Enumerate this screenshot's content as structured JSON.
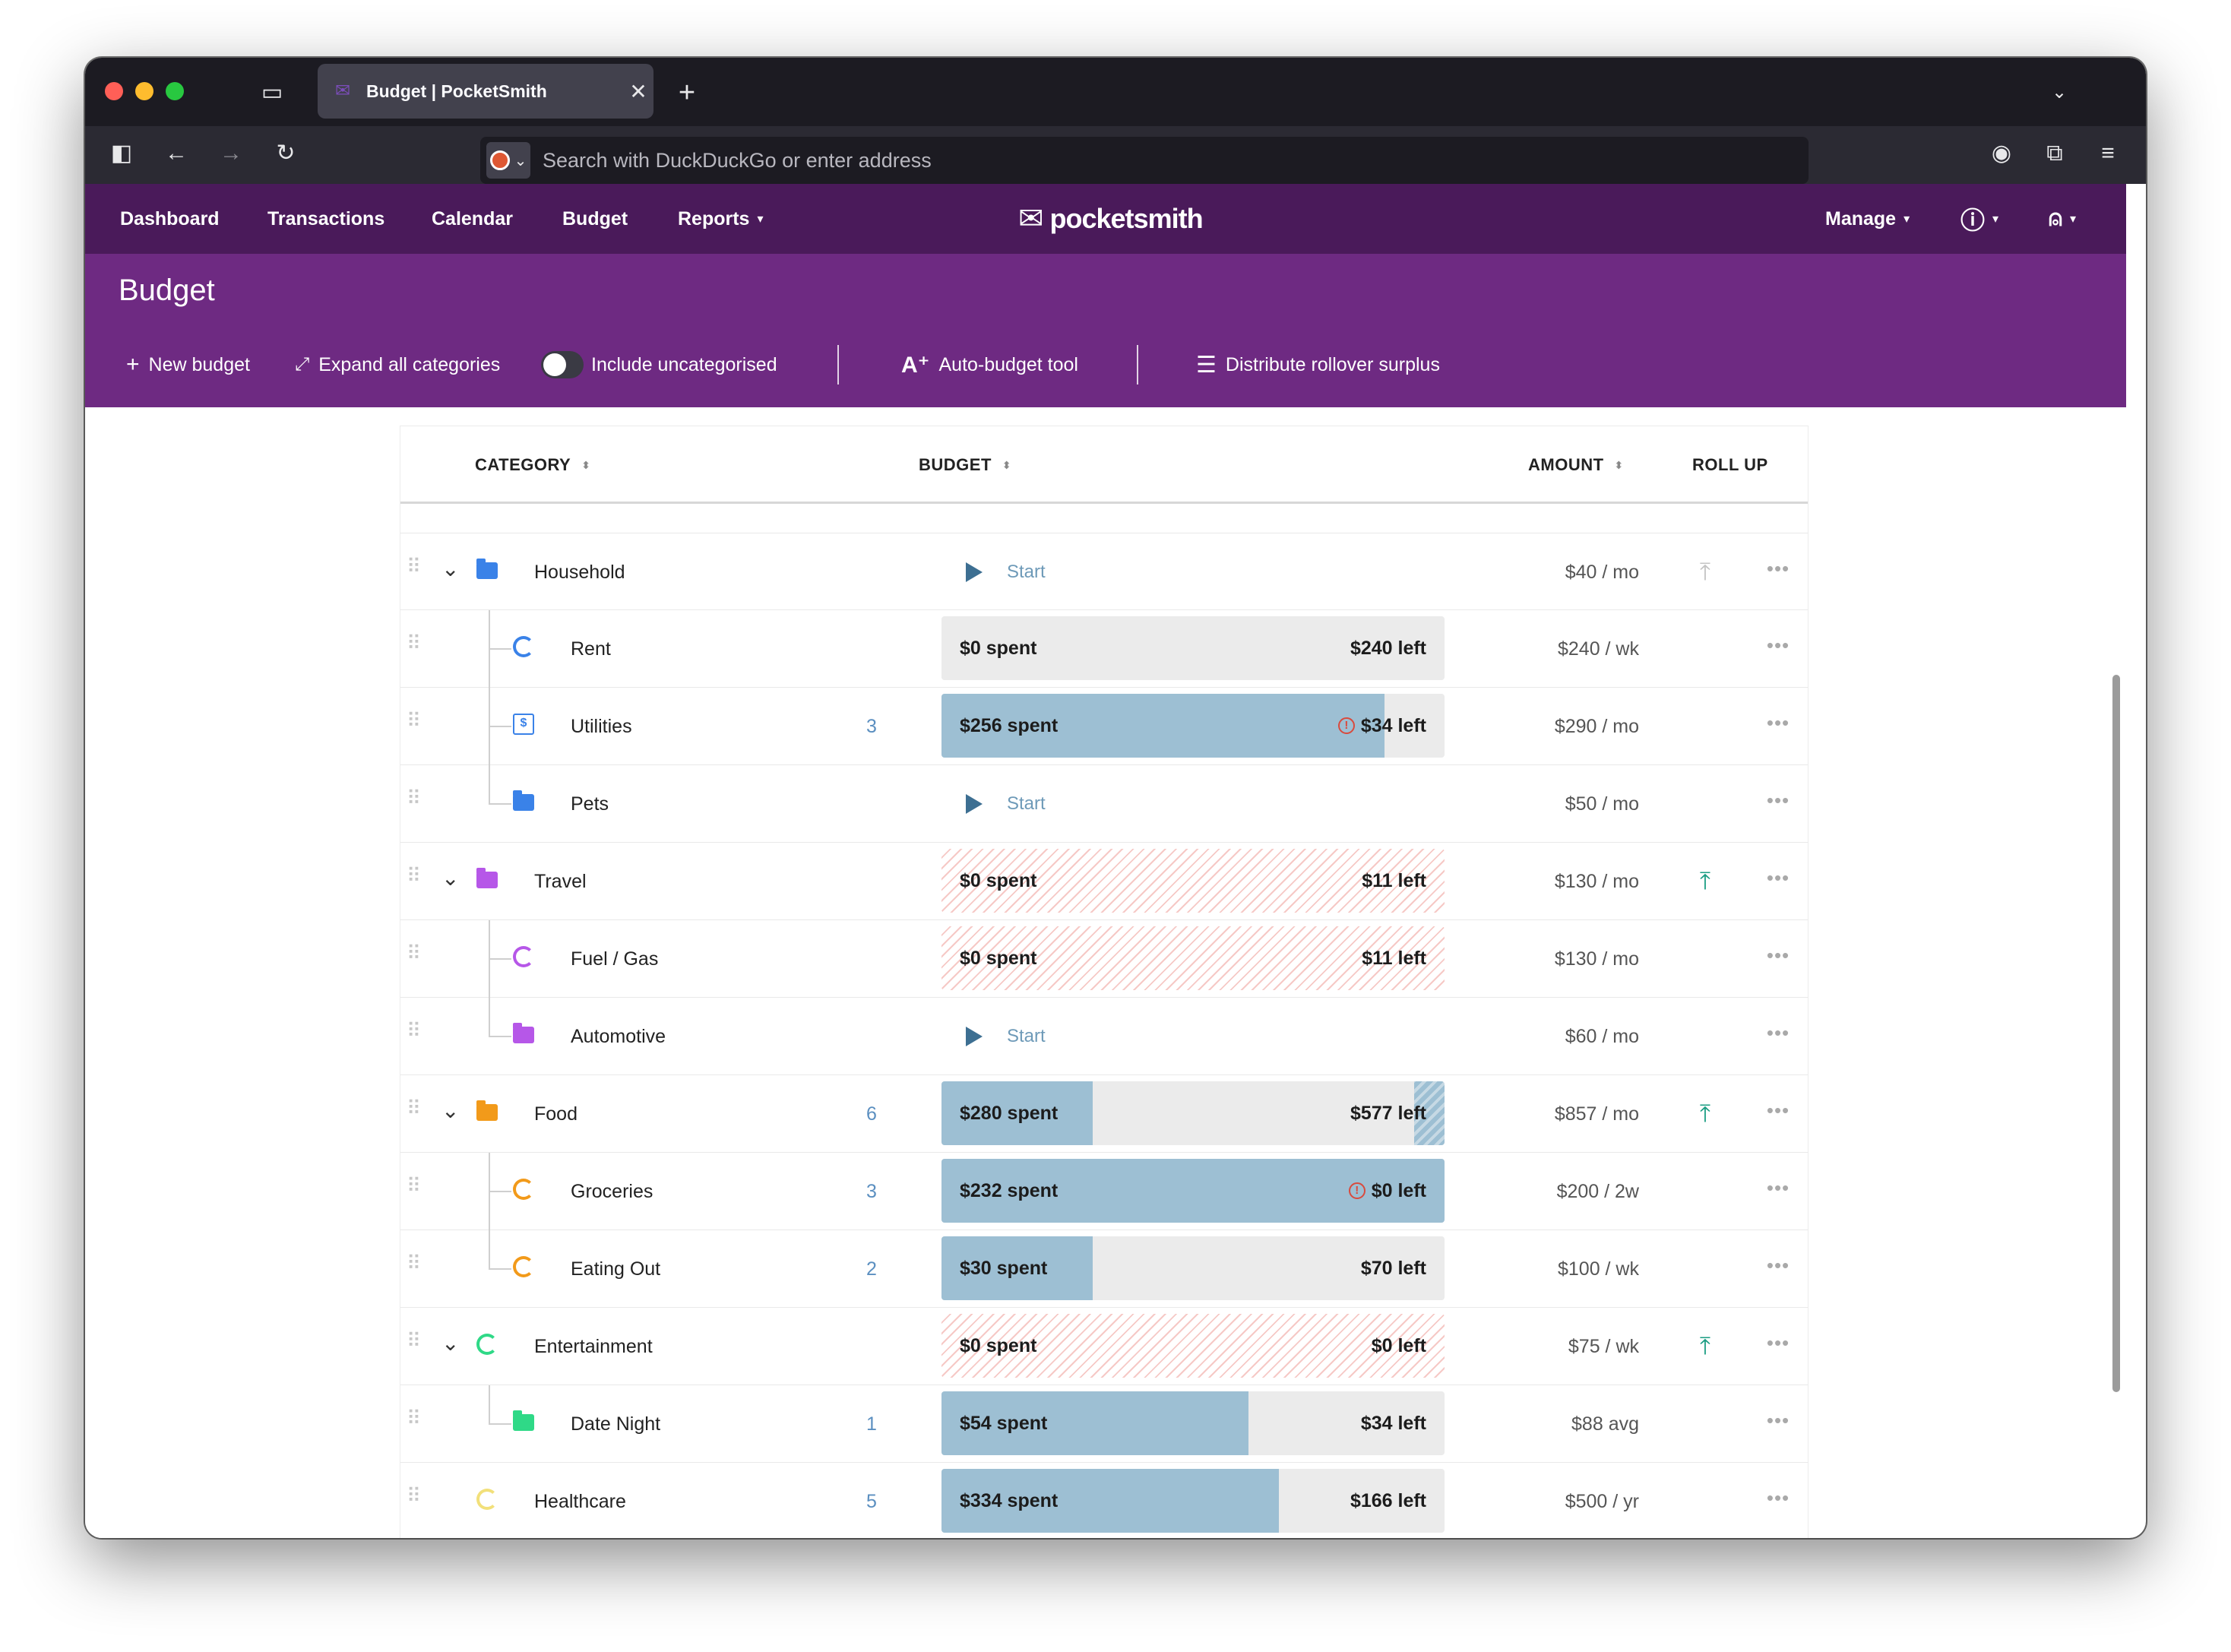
{
  "browser": {
    "tab_title": "Budget | PocketSmith",
    "tab_close": "✕",
    "new_tab": "+",
    "url_placeholder": "Search with DuckDuckGo or enter address"
  },
  "app": {
    "nav": {
      "dashboard": "Dashboard",
      "transactions": "Transactions",
      "calendar": "Calendar",
      "budget": "Budget",
      "reports": "Reports",
      "manage": "Manage"
    },
    "logo": "pocketsmith",
    "brand_color": "#6e2a82",
    "nav_color": "#4a1a5a"
  },
  "page": {
    "title": "Budget",
    "toolbar": {
      "new_budget": "New budget",
      "expand": "Expand all categories",
      "include_uncat": "Include uncategorised",
      "auto_budget": "Auto-budget tool",
      "distribute": "Distribute rollover surplus"
    }
  },
  "table": {
    "headers": {
      "category": "CATEGORY",
      "budget": "BUDGET",
      "amount": "AMOUNT",
      "rollup": "ROLL UP"
    },
    "start_label": "Start",
    "rows": [
      {
        "name": "Household",
        "level": 0,
        "icon": "folder",
        "color": "#3a82e8",
        "count": "",
        "type": "start",
        "amount": "$40 / mo",
        "rollup": "off"
      },
      {
        "name": "Rent",
        "level": 1,
        "icon": "ring",
        "color": "#3a82e8",
        "count": "",
        "type": "bar",
        "spent": "$0 spent",
        "left": "$240 left",
        "fill": 0,
        "striped": false,
        "warn": false,
        "amount": "$240 / wk",
        "rollup": ""
      },
      {
        "name": "Utilities",
        "level": 1,
        "icon": "bill",
        "color": "#3a82e8",
        "count": "3",
        "type": "bar",
        "spent": "$256 spent",
        "left": "$34 left",
        "fill": 0.88,
        "striped": false,
        "warn": true,
        "amount": "$290 / mo",
        "rollup": ""
      },
      {
        "name": "Pets",
        "level": 1,
        "icon": "folder",
        "color": "#3a82e8",
        "count": "",
        "type": "start",
        "amount": "$50 / mo",
        "rollup": ""
      },
      {
        "name": "Travel",
        "level": 0,
        "icon": "folder",
        "color": "#b657e8",
        "count": "",
        "type": "bar",
        "spent": "$0 spent",
        "left": "$11 left",
        "fill": 0,
        "striped": true,
        "warn": false,
        "amount": "$130 / mo",
        "rollup": "on"
      },
      {
        "name": "Fuel / Gas",
        "level": 1,
        "icon": "ring",
        "color": "#b657e8",
        "count": "",
        "type": "bar",
        "spent": "$0 spent",
        "left": "$11 left",
        "fill": 0,
        "striped": true,
        "warn": false,
        "amount": "$130 / mo",
        "rollup": ""
      },
      {
        "name": "Automotive",
        "level": 1,
        "icon": "folder",
        "color": "#b657e8",
        "count": "",
        "type": "start",
        "amount": "$60 / mo",
        "rollup": ""
      },
      {
        "name": "Food",
        "level": 0,
        "icon": "folder",
        "color": "#f29a1a",
        "count": "6",
        "type": "bar",
        "spent": "$280 spent",
        "left": "$577 left",
        "fill": 0.3,
        "striped": false,
        "warn": false,
        "cap": 0.06,
        "amount": "$857 / mo",
        "rollup": "on"
      },
      {
        "name": "Groceries",
        "level": 1,
        "icon": "ring",
        "color": "#f29a1a",
        "count": "3",
        "type": "bar",
        "spent": "$232 spent",
        "left": "$0 left",
        "fill": 1,
        "striped": false,
        "warn": true,
        "amount": "$200 / 2w",
        "rollup": ""
      },
      {
        "name": "Eating Out",
        "level": 1,
        "icon": "ring",
        "color": "#f29a1a",
        "count": "2",
        "type": "bar",
        "spent": "$30 spent",
        "left": "$70 left",
        "fill": 0.3,
        "striped": false,
        "warn": false,
        "amount": "$100 / wk",
        "rollup": ""
      },
      {
        "name": "Entertainment",
        "level": 0,
        "icon": "ring",
        "color": "#2fd987",
        "count": "",
        "type": "bar",
        "spent": "$0 spent",
        "left": "$0 left",
        "fill": 0,
        "striped": true,
        "warn": false,
        "amount": "$75 / wk",
        "rollup": "on"
      },
      {
        "name": "Date Night",
        "level": 1,
        "icon": "folder",
        "color": "#2fd987",
        "count": "1",
        "type": "bar",
        "spent": "$54 spent",
        "left": "$34 left",
        "fill": 0.61,
        "striped": false,
        "warn": false,
        "amount": "$88 avg",
        "rollup": ""
      },
      {
        "name": "Healthcare",
        "level": 0,
        "icon": "ring",
        "color": "#f2e07a",
        "count": "5",
        "type": "bar",
        "spent": "$334 spent",
        "left": "$166 left",
        "fill": 0.67,
        "striped": false,
        "warn": false,
        "amount": "$500 / yr",
        "rollup": "",
        "nochev": true
      }
    ]
  }
}
